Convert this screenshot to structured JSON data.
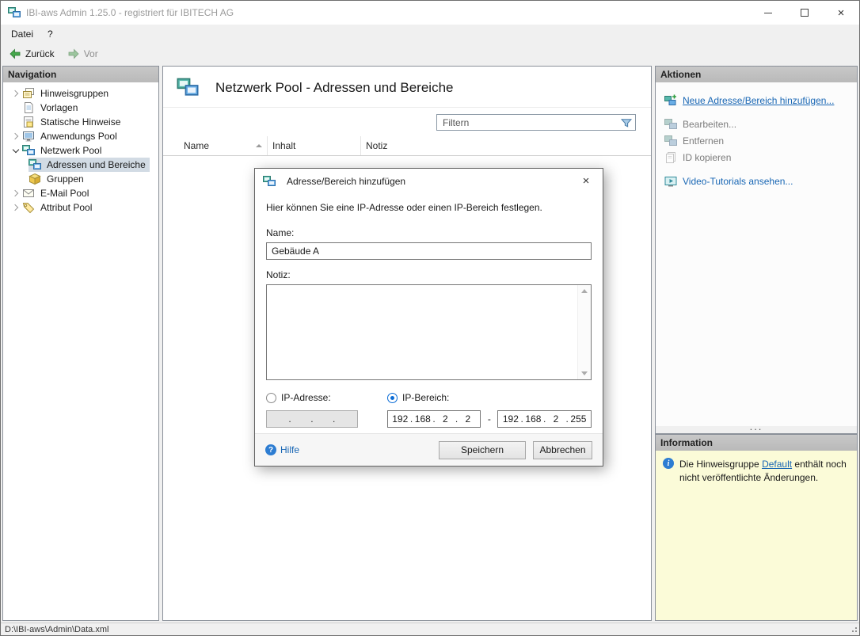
{
  "titlebar": {
    "title": "IBI-aws Admin 1.25.0 - registriert für IBITECH AG",
    "close_glyph": "×"
  },
  "menubar": {
    "file": "Datei",
    "help": "?"
  },
  "toolbar": {
    "back": "Zurück",
    "forward": "Vor"
  },
  "navigation": {
    "header": "Navigation",
    "items": [
      {
        "label": "Hinweisgruppen"
      },
      {
        "label": "Vorlagen"
      },
      {
        "label": "Statische Hinweise"
      },
      {
        "label": "Anwendungs Pool"
      },
      {
        "label": "Netzwerk Pool"
      },
      {
        "label": "Adressen und Bereiche"
      },
      {
        "label": "Gruppen"
      },
      {
        "label": "E-Mail Pool"
      },
      {
        "label": "Attribut Pool"
      }
    ]
  },
  "main": {
    "title": "Netzwerk Pool - Adressen und Bereiche",
    "filter_placeholder": "Filtern",
    "columns": {
      "name": "Name",
      "inhalt": "Inhalt",
      "notiz": "Notiz"
    }
  },
  "dialog": {
    "title": "Adresse/Bereich hinzufügen",
    "close_glyph": "×",
    "description": "Hier können Sie eine IP-Adresse oder einen IP-Bereich festlegen.",
    "name_label": "Name:",
    "name_value": "Gebäude A",
    "notiz_label": "Notiz:",
    "notiz_value": "",
    "ip_address_label": "IP-Adresse:",
    "ip_range_label": "IP-Bereich:",
    "range_start": {
      "o1": "192",
      "o2": "168",
      "o3": "2",
      "o4": "2"
    },
    "range_end": {
      "o1": "192",
      "o2": "168",
      "o3": "2",
      "o4": "255"
    },
    "range_dash": "-",
    "help_label": "Hilfe",
    "save_label": "Speichern",
    "cancel_label": "Abbrechen"
  },
  "actions": {
    "header": "Aktionen",
    "items": [
      {
        "label": "Neue Adresse/Bereich hinzufügen..."
      },
      {
        "label": "Bearbeiten..."
      },
      {
        "label": "Entfernen"
      },
      {
        "label": "ID kopieren"
      },
      {
        "label": "Video-Tutorials ansehen..."
      }
    ]
  },
  "splitter": {
    "dots": "..."
  },
  "information": {
    "header": "Information",
    "text_before": "Die Hinweisgruppe ",
    "link_text": "Default",
    "text_after": " enthält noch nicht veröffentlichte Änderungen."
  },
  "statusbar": {
    "path": "D:\\IBI-aws\\Admin\\Data.xml"
  },
  "colors": {
    "link_blue": "#1866b4",
    "selection_gray": "#d2dbe4",
    "info_yellow": "#fbfbd8",
    "panel_header_gray": "#bdbdbd",
    "back_arrow_green": "#46a84c"
  }
}
